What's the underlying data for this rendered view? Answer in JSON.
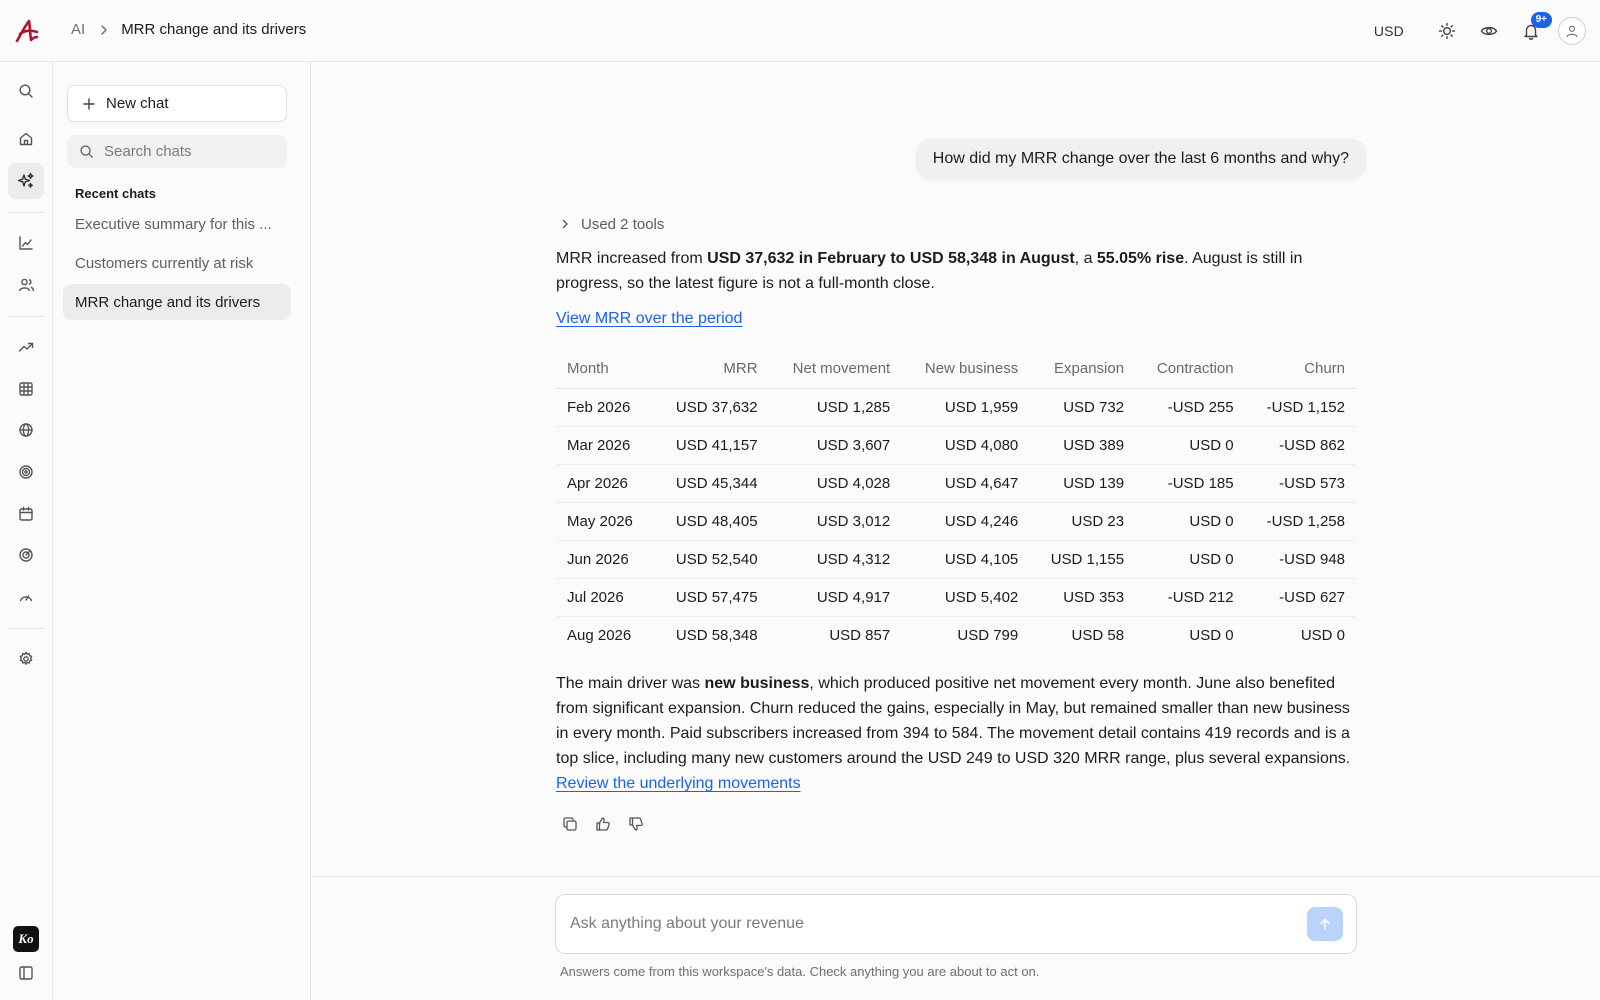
{
  "breadcrumb": {
    "root": "AI",
    "current": "MRR change and its drivers"
  },
  "topbar": {
    "currency": "USD",
    "notifications_badge": "9+"
  },
  "sidebar": {
    "new_chat_label": "New chat",
    "search_placeholder": "Search chats",
    "recent_title": "Recent chats",
    "recent": [
      "Executive summary for this ...",
      "Customers currently at risk",
      "MRR change and its drivers"
    ],
    "active_index": 2
  },
  "rail_icons": [
    "search-icon",
    "home-icon",
    "ai-sparkle-icon",
    "chart-icon",
    "users-icon",
    "trend-icon",
    "table-icon",
    "globe-icon",
    "target-icon",
    "calendar-icon",
    "radar-icon",
    "gauge-icon",
    "settings-icon",
    "ko-logo-icon",
    "sidebar-toggle-icon"
  ],
  "conversation": {
    "user_message": "How did my MRR change over the last 6 months and why?",
    "tools_label": "Used 2 tools",
    "summary": {
      "t1": "MRR increased from ",
      "b1": "USD 37,632 in February to USD 58,348 in August",
      "t2": ", a ",
      "b2": "55.05% rise",
      "t3": ". August is still in progress, so the latest figure is not a full-month close."
    },
    "view_link": "View MRR over the period",
    "table": {
      "headers": [
        "Month",
        "MRR",
        "Net movement",
        "New business",
        "Expansion",
        "Contraction",
        "Churn"
      ],
      "rows": [
        [
          "Feb 2026",
          "USD 37,632",
          "USD 1,285",
          "USD 1,959",
          "USD 732",
          "-USD 255",
          "-USD 1,152"
        ],
        [
          "Mar 2026",
          "USD 41,157",
          "USD 3,607",
          "USD 4,080",
          "USD 389",
          "USD 0",
          "-USD 862"
        ],
        [
          "Apr 2026",
          "USD 45,344",
          "USD 4,028",
          "USD 4,647",
          "USD 139",
          "-USD 185",
          "-USD 573"
        ],
        [
          "May 2026",
          "USD 48,405",
          "USD 3,012",
          "USD 4,246",
          "USD 23",
          "USD 0",
          "-USD 1,258"
        ],
        [
          "Jun 2026",
          "USD 52,540",
          "USD 4,312",
          "USD 4,105",
          "USD 1,155",
          "USD 0",
          "-USD 948"
        ],
        [
          "Jul 2026",
          "USD 57,475",
          "USD 4,917",
          "USD 5,402",
          "USD 353",
          "-USD 212",
          "-USD 627"
        ],
        [
          "Aug 2026",
          "USD 58,348",
          "USD 857",
          "USD 799",
          "USD 58",
          "USD 0",
          "USD 0"
        ]
      ]
    },
    "drivers": {
      "t1": "The main driver was ",
      "b1": "new business",
      "t2": ", which produced positive net movement every month. June also benefited from significant expansion. Churn reduced the gains, especially in May, but remained smaller than new business in every month. Paid subscribers increased from 394 to 584. The movement detail contains 419 records and is a top slice, including many new customers around the USD 249 to USD 320 MRR range, plus several expansions. ",
      "link": "Review the underlying movements"
    }
  },
  "composer": {
    "placeholder": "Ask anything about your revenue",
    "disclaimer": "Answers come from this workspace's data. Check anything you are about to act on."
  },
  "colors": {
    "accent": "#1a63e8",
    "send_disabled": "#b9d3fb",
    "logo": "#b3122e"
  }
}
